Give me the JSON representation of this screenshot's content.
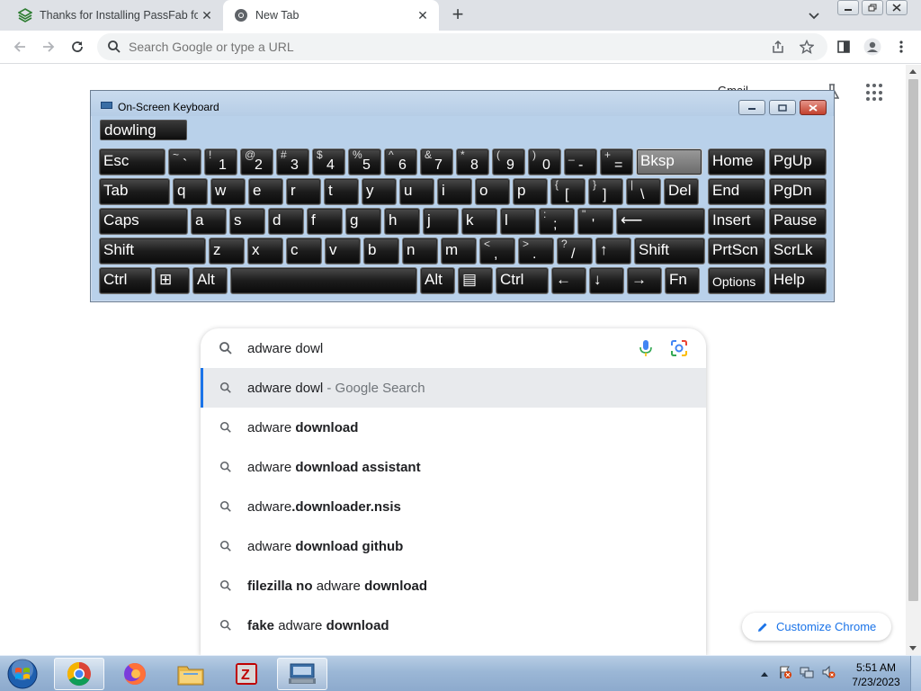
{
  "browser": {
    "tabs": [
      {
        "title": "Thanks for Installing PassFab for",
        "active": false
      },
      {
        "title": "New Tab",
        "active": true
      }
    ],
    "omnibox_placeholder": "Search Google or type a URL"
  },
  "newtab": {
    "gmail_label": "Gmail",
    "search_query": "adware dowl",
    "suggestions": [
      {
        "parts": [
          {
            "t": "adware dowl",
            "b": false
          }
        ],
        "suffix": " - Google Search",
        "selected": true
      },
      {
        "parts": [
          {
            "t": "adware ",
            "b": false
          },
          {
            "t": "download",
            "b": true
          }
        ],
        "suffix": "",
        "selected": false
      },
      {
        "parts": [
          {
            "t": "adware ",
            "b": false
          },
          {
            "t": "download assistant",
            "b": true
          }
        ],
        "suffix": "",
        "selected": false
      },
      {
        "parts": [
          {
            "t": "adware",
            "b": false
          },
          {
            "t": ".downloader.nsis",
            "b": true
          }
        ],
        "suffix": "",
        "selected": false
      },
      {
        "parts": [
          {
            "t": "adware ",
            "b": false
          },
          {
            "t": "download github",
            "b": true
          }
        ],
        "suffix": "",
        "selected": false
      },
      {
        "parts": [
          {
            "t": "filezilla no ",
            "b": true
          },
          {
            "t": "adware ",
            "b": false
          },
          {
            "t": "download",
            "b": true
          }
        ],
        "suffix": "",
        "selected": false
      },
      {
        "parts": [
          {
            "t": "fake ",
            "b": true
          },
          {
            "t": "adware ",
            "b": false
          },
          {
            "t": "download",
            "b": true
          }
        ],
        "suffix": "",
        "selected": false
      }
    ],
    "customize_label": "Customize Chrome"
  },
  "osk": {
    "title": "On-Screen Keyboard",
    "text_field": "dowling",
    "rows": [
      [
        {
          "main": "Esc",
          "w": 2
        },
        {
          "shift": "~",
          "main": "`",
          "w": 1
        },
        {
          "shift": "!",
          "main": "1",
          "w": 1
        },
        {
          "shift": "@",
          "main": "2",
          "w": 1
        },
        {
          "shift": "#",
          "main": "3",
          "w": 1
        },
        {
          "shift": "$",
          "main": "4",
          "w": 1
        },
        {
          "shift": "%",
          "main": "5",
          "w": 1
        },
        {
          "shift": "^",
          "main": "6",
          "w": 1
        },
        {
          "shift": "&",
          "main": "7",
          "w": 1
        },
        {
          "shift": "*",
          "main": "8",
          "w": 1
        },
        {
          "shift": "(",
          "main": "9",
          "w": 1
        },
        {
          "shift": ")",
          "main": "0",
          "w": 1
        },
        {
          "shift": "_",
          "main": "-",
          "w": 1
        },
        {
          "shift": "+",
          "main": "=",
          "w": 1
        },
        {
          "main": "Bksp",
          "w": 2,
          "hover": true
        }
      ],
      [
        {
          "main": "Tab",
          "w": 2
        },
        {
          "main": "q",
          "w": 1
        },
        {
          "main": "w",
          "w": 1
        },
        {
          "main": "e",
          "w": 1
        },
        {
          "main": "r",
          "w": 1
        },
        {
          "main": "t",
          "w": 1
        },
        {
          "main": "y",
          "w": 1
        },
        {
          "main": "u",
          "w": 1
        },
        {
          "main": "i",
          "w": 1
        },
        {
          "main": "o",
          "w": 1
        },
        {
          "main": "p",
          "w": 1
        },
        {
          "shift": "{",
          "main": "[",
          "w": 1
        },
        {
          "shift": "}",
          "main": "]",
          "w": 1
        },
        {
          "shift": "|",
          "main": "\\",
          "w": 1
        },
        {
          "main": "Del",
          "w": 1
        }
      ],
      [
        {
          "main": "Caps",
          "w": 2.5
        },
        {
          "main": "a",
          "w": 1
        },
        {
          "main": "s",
          "w": 1
        },
        {
          "main": "d",
          "w": 1
        },
        {
          "main": "f",
          "w": 1
        },
        {
          "main": "g",
          "w": 1
        },
        {
          "main": "h",
          "w": 1
        },
        {
          "main": "j",
          "w": 1
        },
        {
          "main": "k",
          "w": 1
        },
        {
          "main": "l",
          "w": 1
        },
        {
          "shift": ":",
          "main": ";",
          "w": 1
        },
        {
          "shift": "\"",
          "main": "'",
          "w": 1
        },
        {
          "main": "⟵",
          "w": 2.5
        }
      ],
      [
        {
          "main": "Shift",
          "w": 3
        },
        {
          "main": "z",
          "w": 1
        },
        {
          "main": "x",
          "w": 1
        },
        {
          "main": "c",
          "w": 1
        },
        {
          "main": "v",
          "w": 1
        },
        {
          "main": "b",
          "w": 1
        },
        {
          "main": "n",
          "w": 1
        },
        {
          "main": "m",
          "w": 1
        },
        {
          "shift": "<",
          "main": ",",
          "w": 1
        },
        {
          "shift": ">",
          "main": ".",
          "w": 1
        },
        {
          "shift": "?",
          "main": "/",
          "w": 1
        },
        {
          "main": "↑",
          "w": 1
        },
        {
          "main": "Shift",
          "w": 2
        }
      ],
      [
        {
          "main": "Ctrl",
          "w": 1.5
        },
        {
          "main": "⊞",
          "w": 1,
          "icon": "windows-logo"
        },
        {
          "main": "Alt",
          "w": 1
        },
        {
          "main": "",
          "w": 5.3,
          "name": "space"
        },
        {
          "main": "Alt",
          "w": 1
        },
        {
          "main": "▤",
          "w": 1,
          "icon": "menu"
        },
        {
          "main": "Ctrl",
          "w": 1.5
        },
        {
          "main": "←",
          "w": 1
        },
        {
          "main": "↓",
          "w": 1
        },
        {
          "main": "→",
          "w": 1
        },
        {
          "main": "Fn",
          "w": 1
        }
      ]
    ],
    "nav_keys": [
      [
        "Home",
        "PgUp"
      ],
      [
        "End",
        "PgDn"
      ],
      [
        "Insert",
        "Pause"
      ],
      [
        "PrtScn",
        "ScrLk"
      ],
      [
        "Options",
        "Help"
      ]
    ]
  },
  "taskbar": {
    "apps": [
      "chrome",
      "firefox",
      "explorer",
      "filezilla",
      "on-screen-keyboard"
    ],
    "time": "5:51 AM",
    "date": "7/23/2023"
  }
}
